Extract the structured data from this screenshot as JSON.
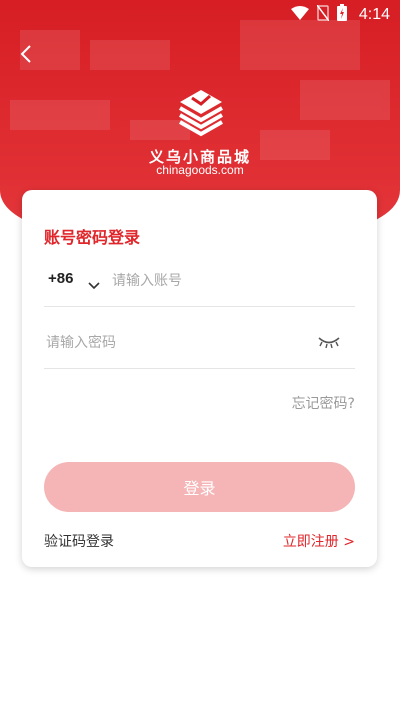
{
  "colors": {
    "brand_red": "#e0262a",
    "button_disabled": "#f5b5b7",
    "placeholder": "#a8a8a8"
  },
  "status_bar": {
    "time": "4:14",
    "icons": [
      "wifi-icon",
      "no-sim-icon",
      "battery-charging-icon"
    ]
  },
  "header": {
    "back_icon": "back-arrow-icon",
    "brand_name": "义乌小商品城",
    "brand_domain": "chinagoods.com"
  },
  "login_card": {
    "title": "账号密码登录",
    "country_code": "+86",
    "account_placeholder": "请输入账号",
    "password_placeholder": "请输入密码",
    "forgot_password": "忘记密码?",
    "login_button": "登录",
    "sms_login": "验证码登录",
    "register": "立即注册 >"
  }
}
